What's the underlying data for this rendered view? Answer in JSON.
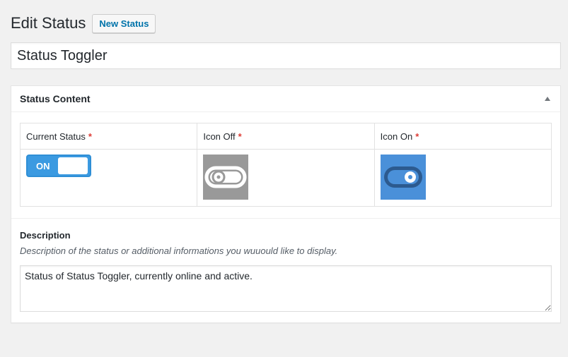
{
  "header": {
    "title": "Edit Status",
    "new_button_label": "New Status"
  },
  "post_title": {
    "value": "Status Toggler"
  },
  "metabox": {
    "title": "Status Content",
    "toggle_icon": "triangle-up-icon",
    "columns": [
      {
        "label": "Current Status",
        "required_mark": "*"
      },
      {
        "label": "Icon Off",
        "required_mark": "*"
      },
      {
        "label": "Icon On",
        "required_mark": "*"
      }
    ],
    "current_status": {
      "label": "ON",
      "is_on": true
    },
    "icon_off": {
      "icon": "toggle-off-icon",
      "background": "#999999"
    },
    "icon_on": {
      "icon": "toggle-on-icon",
      "background": "#4a90d9"
    },
    "description": {
      "label": "Description",
      "hint": "Description of the status or additional informations you wuuould like to display.",
      "value": "Status of Status Toggler, currently online and active."
    }
  },
  "colors": {
    "accent": "#0073aa",
    "required": "#dd3d36",
    "switch_on": "#3b9ae1"
  }
}
